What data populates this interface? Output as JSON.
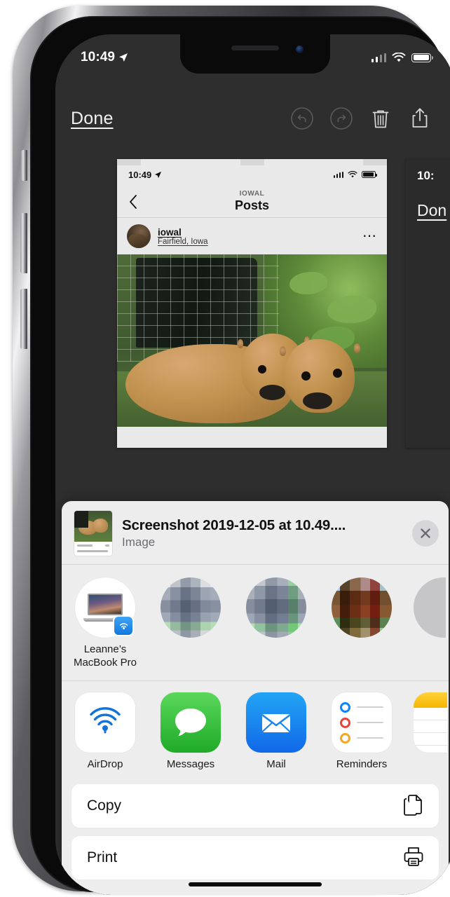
{
  "device": {
    "status_bar": {
      "time": "10:49",
      "location_icon": "location-arrow-icon",
      "cellular_icon": "cellular-bars-icon",
      "wifi_icon": "wifi-icon",
      "battery_icon": "battery-full-icon"
    },
    "home_indicator": "home-indicator"
  },
  "editor": {
    "done_label": "Done",
    "undo_icon": "undo-circle-icon",
    "redo_icon": "redo-circle-icon",
    "delete_icon": "trash-icon",
    "share_icon": "share-up-arrow-icon"
  },
  "screenshot_preview": {
    "status_time": "10:49",
    "back_icon": "chevron-left-icon",
    "nav_kicker": "IOWAL",
    "nav_title": "Posts",
    "post_username": "iowal",
    "post_location": "Fairfield, Iowa",
    "more_icon": "ellipsis-icon",
    "photo_alt": "two-brown-calves-lying-in-grass"
  },
  "screenshot_preview_next": {
    "status_time": "10:",
    "done_label": "Don"
  },
  "share_sheet": {
    "title": "Screenshot 2019-12-05 at 10.49....",
    "subtitle": "Image",
    "close_icon": "close-x-icon",
    "thumbnail_alt": "screenshot-thumbnail",
    "airdrop_targets": [
      {
        "label_line1": "Leanne’s",
        "label_line2": "MacBook Pro",
        "icon": "macbook-pro-icon",
        "badge_icon": "airdrop-badge-icon",
        "blurred": false
      },
      {
        "label_line1": "",
        "label_line2": "",
        "icon": "contact-avatar-icon",
        "blurred": true
      },
      {
        "label_line1": "",
        "label_line2": "",
        "icon": "contact-avatar-icon",
        "blurred": true
      },
      {
        "label_line1": "",
        "label_line2": "",
        "icon": "contact-avatar-icon",
        "blurred": true
      },
      {
        "label_line1": "",
        "label_line2": "",
        "icon": "contact-avatar-icon",
        "blurred": true
      }
    ],
    "apps": [
      {
        "label": "AirDrop",
        "icon": "airdrop-icon"
      },
      {
        "label": "Messages",
        "icon": "messages-icon"
      },
      {
        "label": "Mail",
        "icon": "mail-icon"
      },
      {
        "label": "Reminders",
        "icon": "reminders-icon"
      },
      {
        "label": "",
        "icon": "notes-icon"
      }
    ],
    "actions": [
      {
        "label": "Copy",
        "icon": "copy-pages-icon"
      },
      {
        "label": "Print",
        "icon": "printer-icon"
      }
    ]
  },
  "colors": {
    "sheet_bg": "#ededed",
    "editor_bg": "#2e2e2e",
    "messages_green": "#35c63f",
    "mail_blue": "#1b86f0",
    "airdrop_blue": "#1278dd",
    "notes_yellow": "#f7b500",
    "reminder_blue": "#0a84ff",
    "reminder_red": "#e8443a",
    "reminder_orange": "#f5a623"
  }
}
